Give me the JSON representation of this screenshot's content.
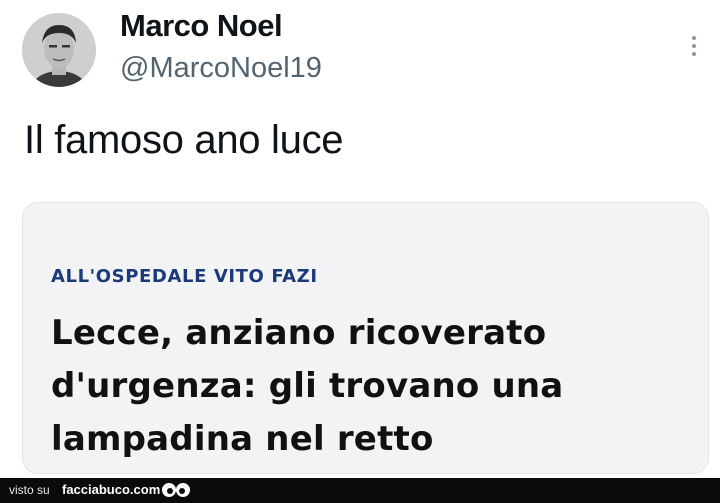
{
  "tweet": {
    "display_name": "Marco Noel",
    "handle": "@MarcoNoel19",
    "text": "Il famoso ano luce",
    "avatar_icon": "profile-photo",
    "more_icon": "more-vertical-icon"
  },
  "card": {
    "kicker": "ALL'OSPEDALE VITO FAZI",
    "headline_lines": [
      "Lecce, anziano ricoverato",
      "d'urgenza: gli trovano una",
      "lampadina nel retto"
    ]
  },
  "footer": {
    "visto_su": "visto su",
    "site": "facciabuco.com",
    "logo_icon": "eyes-icon"
  },
  "colors": {
    "kicker": "#1c3a78",
    "card_bg": "#f2f3f5",
    "handle": "#536471"
  }
}
